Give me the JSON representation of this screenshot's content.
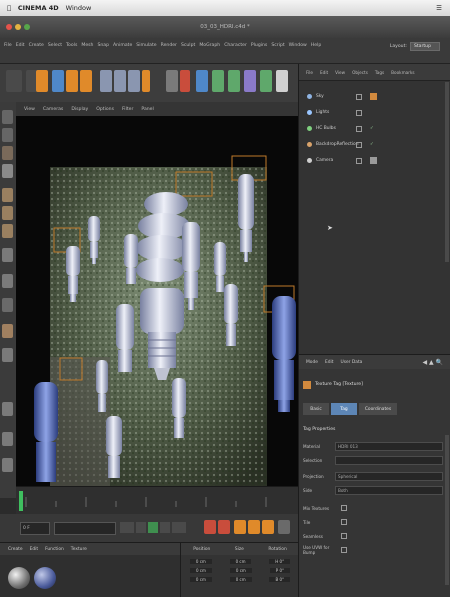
{
  "mac_menu": {
    "app_name": "CINEMA 4D",
    "window_menu": "Window"
  },
  "window_title": "03_03_HDRI.c4d *",
  "menubar": {
    "items": [
      "File",
      "Edit",
      "Create",
      "Select",
      "Tools",
      "Mesh",
      "Snap",
      "Animate",
      "Simulate",
      "Render",
      "Sculpt",
      "MoGraph",
      "Character",
      "Plugins",
      "Script",
      "Window",
      "Help"
    ],
    "layout_label": "Layout:",
    "layout_value": "Startup"
  },
  "viewport_menu": [
    "View",
    "Cameras",
    "Display",
    "Options",
    "Filter",
    "Panel"
  ],
  "object_manager": {
    "menu": [
      "File",
      "Edit",
      "View",
      "Objects",
      "Tags",
      "Bookmarks"
    ],
    "objects": [
      {
        "name": "Sky",
        "color": "#8fb4e3"
      },
      {
        "name": "Lights",
        "color": "#9ac6ff"
      },
      {
        "name": "HC Bulbs",
        "color": "#7fd07f"
      },
      {
        "name": "BackdropReflection",
        "color": "#d9a36b"
      },
      {
        "name": "Camera",
        "color": "#cfcfcf"
      }
    ]
  },
  "attribute_manager": {
    "menu": [
      "Mode",
      "Edit",
      "User Data"
    ],
    "header": "Texture Tag [Texture]",
    "tabs": [
      "Basic",
      "Tag",
      "Coordinates"
    ],
    "section": "Tag Properties",
    "properties": [
      {
        "label": "Material",
        "value": "HDRI 013"
      },
      {
        "label": "Selection",
        "value": ""
      },
      {
        "label": "Projection",
        "value": "Spherical"
      },
      {
        "label": "Side",
        "value": "Both"
      },
      {
        "label": "Mix Textures",
        "value": ""
      },
      {
        "label": "Tile",
        "value": ""
      },
      {
        "label": "Seamless",
        "value": ""
      },
      {
        "label": "Use UVW for Bump",
        "value": ""
      }
    ]
  },
  "material_manager": {
    "menu": [
      "Create",
      "Edit",
      "Function",
      "Texture"
    ]
  },
  "coordinates": {
    "headers": [
      "Position",
      "Size",
      "Rotation"
    ],
    "rows": [
      [
        "0 cm",
        "0 cm",
        "H 0°"
      ],
      [
        "0 cm",
        "0 cm",
        "P 0°"
      ],
      [
        "0 cm",
        "0 cm",
        "B 0°"
      ]
    ]
  },
  "transport": {
    "frame_field": "0 F",
    "end_field": "90 F"
  },
  "colors": {
    "accent_orange": "#e08a2a",
    "selection_blue": "#4f88c9"
  }
}
